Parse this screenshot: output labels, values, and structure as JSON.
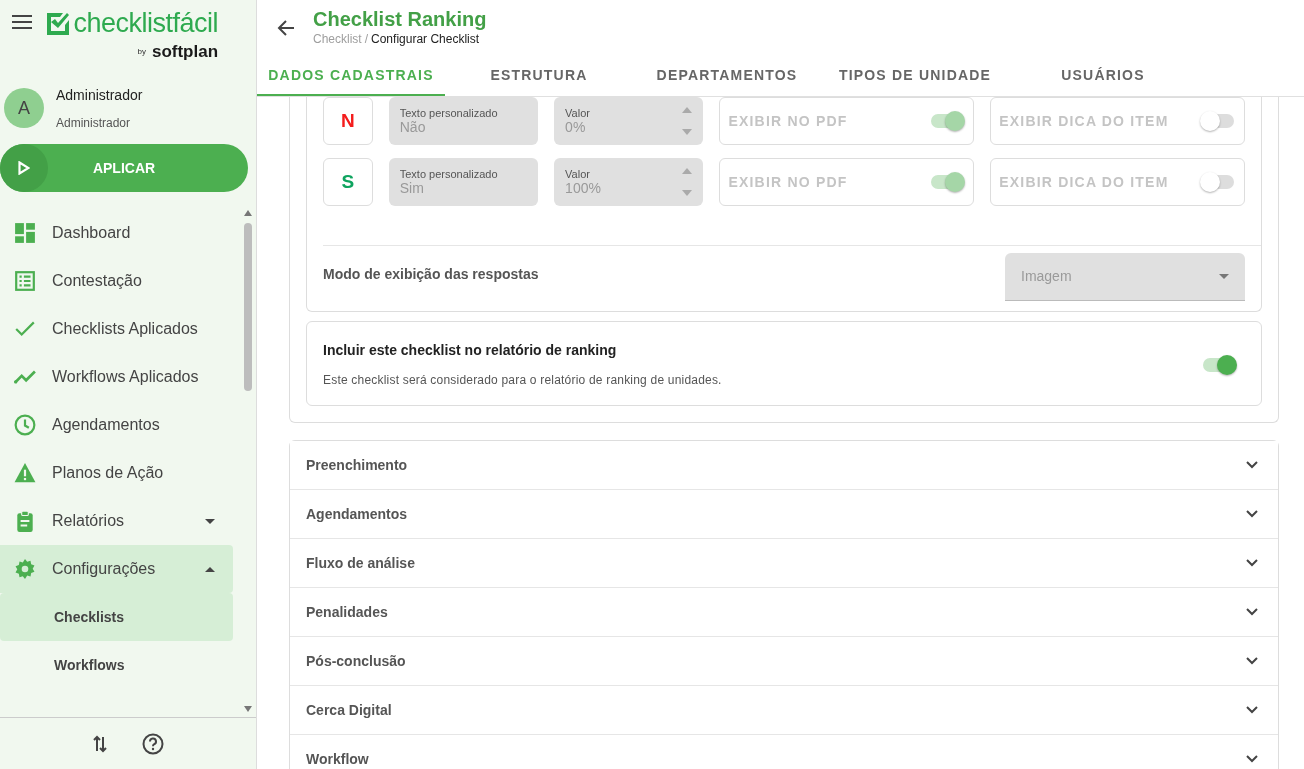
{
  "app": {
    "logo": "checklistfácil",
    "logo_by": "by",
    "logo_brand": "softplan"
  },
  "user": {
    "initial": "A",
    "name": "Administrador",
    "role": "Administrador"
  },
  "apply_button": "APLICAR",
  "sidebar": {
    "items": [
      {
        "label": "Dashboard",
        "selected": false
      },
      {
        "label": "Contestação",
        "selected": false
      },
      {
        "label": "Checklists Aplicados",
        "selected": false
      },
      {
        "label": "Workflows Aplicados",
        "selected": false
      },
      {
        "label": "Agendamentos",
        "selected": false
      },
      {
        "label": "Planos de Ação",
        "selected": false
      },
      {
        "label": "Relatórios",
        "selected": false,
        "expanded": false
      },
      {
        "label": "Configurações",
        "selected": true,
        "expanded": true,
        "children": [
          {
            "label": "Checklists",
            "selected": true
          },
          {
            "label": "Workflows",
            "selected": false
          }
        ]
      }
    ]
  },
  "header": {
    "title": "Checklist Ranking",
    "breadcrumb": [
      "Checklist",
      "Configurar Checklist"
    ],
    "breadcrumb_separator": "/"
  },
  "tabs": [
    {
      "label": "DADOS CADASTRAIS",
      "selected": true
    },
    {
      "label": "ESTRUTURA",
      "selected": false
    },
    {
      "label": "DEPARTAMENTOS",
      "selected": false
    },
    {
      "label": "TIPOS DE UNIDADE",
      "selected": false
    },
    {
      "label": "USUÁRIOS",
      "selected": false
    }
  ],
  "answers": [
    {
      "letter": "N",
      "color": "#f41c1c",
      "text_label": "Texto personalizado",
      "text_value": "Não",
      "value_label": "Valor",
      "value": "0%",
      "pdf_label": "EXIBIR NO PDF",
      "pdf_on": true,
      "hint_label": "EXIBIR DICA DO ITEM",
      "hint_on": false
    },
    {
      "letter": "S",
      "color": "#0fa45f",
      "text_label": "Texto personalizado",
      "text_value": "Sim",
      "value_label": "Valor",
      "value": "100%",
      "pdf_label": "EXIBIR NO PDF",
      "pdf_on": true,
      "hint_label": "EXIBIR DICA DO ITEM",
      "hint_on": false
    }
  ],
  "display_mode": {
    "label": "Modo de exibição das respostas",
    "value": "Imagem"
  },
  "ranking": {
    "title": "Incluir este checklist no relatório de ranking",
    "description": "Este checklist será considerado para o relatório de ranking de unidades.",
    "on": true
  },
  "sections": [
    {
      "title": "Preenchimento"
    },
    {
      "title": "Agendamentos"
    },
    {
      "title": "Fluxo de análise"
    },
    {
      "title": "Penalidades"
    },
    {
      "title": "Pós-conclusão"
    },
    {
      "title": "Cerca Digital"
    },
    {
      "title": "Workflow"
    }
  ]
}
